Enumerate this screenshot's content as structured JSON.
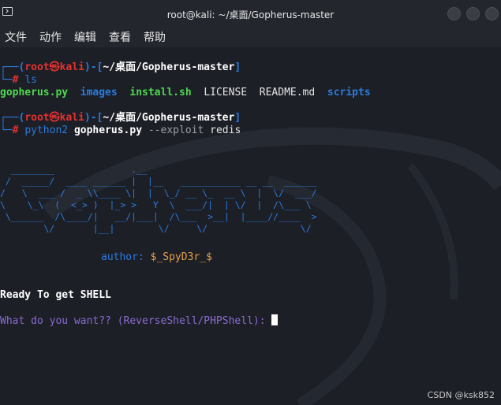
{
  "window": {
    "title": "root@kali: ~/桌面/Gopherus-master"
  },
  "menu": [
    {
      "label": "文件"
    },
    {
      "label": "动作"
    },
    {
      "label": "编辑"
    },
    {
      "label": "查看"
    },
    {
      "label": "帮助"
    }
  ],
  "prompt": {
    "open": "┌──(",
    "user": "root㉿kali",
    "mid": ")-[",
    "path": "~/桌面/Gopherus-master",
    "close": "]",
    "corner": "└─",
    "symbol": "#"
  },
  "commands": [
    {
      "cmd": "ls"
    },
    {
      "cmd": "python2",
      "arg1": "gopherus.py",
      "arg2": "--exploit",
      "arg3": "redis"
    }
  ],
  "ls_output": [
    {
      "name": "gopherus.py",
      "kind": "exec"
    },
    {
      "name": "images",
      "kind": "dir"
    },
    {
      "name": "install.sh",
      "kind": "exec"
    },
    {
      "name": "LICENSE",
      "kind": "file"
    },
    {
      "name": "README.md",
      "kind": "file"
    },
    {
      "name": "scripts",
      "kind": "dir"
    }
  ],
  "banner": {
    "ascii": "  ________              .__\n /  _____/  ____ ______ |  |__   ___________ __ __  ______\n/   \\  ___ /  _ \\\\____ \\|  |  \\_/ __ \\_  __ \\  |  \\/  ___/\n\\    \\_\\  (  <_> )  |_> >   Y  \\  ___/|  | \\/  |  /\\___ \\\n \\______  /\\____/|   __/|___|  /\\___  >__|  |____//____  >\n        \\/       |__|        \\/     \\/                 \\/",
    "author_label": "author:",
    "author_name": "$_SpyD3r_$"
  },
  "status": "Ready To get SHELL",
  "question": "What do you want?? (ReverseShell/PHPShell): ",
  "credit": "CSDN @ksk852",
  "colors": {
    "prompt_blue": "#2a7bde",
    "user_red": "#e5302f",
    "exec_green": "#4ed84e",
    "question_purple": "#8c6bd1",
    "author_orange": "#e6a04a"
  }
}
